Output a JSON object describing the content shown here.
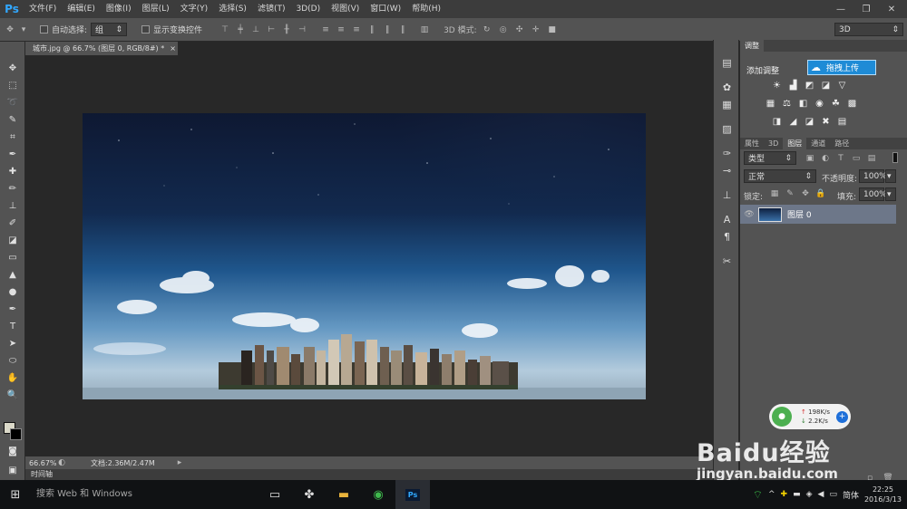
{
  "app": {
    "logo": "Ps"
  },
  "menu": [
    "文件(F)",
    "编辑(E)",
    "图像(I)",
    "图层(L)",
    "文字(Y)",
    "选择(S)",
    "滤镜(T)",
    "3D(D)",
    "视图(V)",
    "窗口(W)",
    "帮助(H)"
  ],
  "options": {
    "auto_select_label": "自动选择:",
    "auto_select_value": "组",
    "show_transform_label": "显示变换控件",
    "mode_3d_label": "3D 模式:",
    "workspace": "3D"
  },
  "document": {
    "tab_title": "城市.jpg @ 66.7% (图层 0, RGB/8#) *",
    "close": "×"
  },
  "status": {
    "zoom": "66.67%",
    "doc_size": "文档:2.36M/2.47M"
  },
  "timeline_label": "时间轴",
  "adjust_panel": {
    "tab": "调整",
    "add_label": "添加调整",
    "upload_label": "拖拽上传"
  },
  "layers_panel": {
    "tabs": [
      "属性",
      "3D",
      "图层",
      "通道",
      "路径"
    ],
    "active_tab": "图层",
    "filter_kind": "类型",
    "blend_mode": "正常",
    "opacity_label": "不透明度:",
    "opacity_value": "100%",
    "lock_label": "锁定:",
    "fill_label": "填充:",
    "fill_value": "100%",
    "layers": [
      {
        "name": "图层 0",
        "visible": true
      }
    ]
  },
  "net_widget": {
    "upload": "198K/s",
    "download": "2.2K/s"
  },
  "watermark": {
    "brand": "Baidu经验",
    "url": "jingyan.baidu.com"
  },
  "taskbar": {
    "search_placeholder": "搜索 Web 和 Windows",
    "ime": "简体",
    "time": "22:25",
    "date": "2016/3/13"
  },
  "colors": {
    "ps_blue": "#31a8ff",
    "panel": "#535353",
    "canvas_bg": "#282828",
    "accent": "#1e8bd6"
  }
}
